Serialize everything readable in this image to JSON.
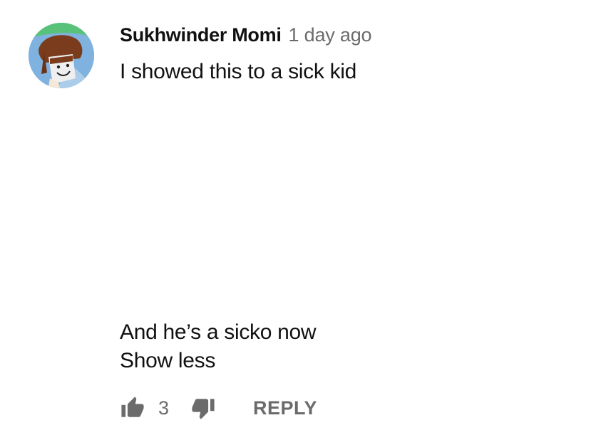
{
  "comment": {
    "author": "Sukhwinder Momi",
    "timestamp": "1 day ago",
    "text_line_1": "I showed this to a sick kid",
    "text_line_2": "And he’s a sicko now",
    "show_less_label": "Show less",
    "avatar": {
      "description_icon": "avatar-image"
    }
  },
  "actions": {
    "like_icon": "thumbs-up-icon",
    "like_count": "3",
    "dislike_icon": "thumbs-down-icon",
    "reply_label": "REPLY"
  },
  "colors": {
    "text_primary": "#111111",
    "text_secondary": "#6b6b6b",
    "icon": "#6b6b6b",
    "background": "#ffffff"
  }
}
